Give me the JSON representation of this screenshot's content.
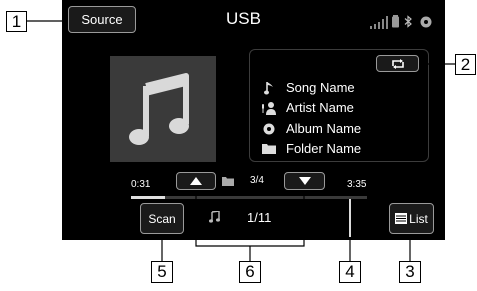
{
  "header": {
    "source_label": "Source",
    "title": "USB"
  },
  "track_info": {
    "song": "Song Name",
    "artist": "Artist Name",
    "album": "Album Name",
    "folder": "Folder Name"
  },
  "folder_nav": {
    "position": "3/4"
  },
  "playback": {
    "elapsed": "0:31",
    "total": "3:35",
    "progress_fraction": 0.144
  },
  "bottom_bar": {
    "scan_label": "Scan",
    "track_counter": "1/11",
    "list_label": "List"
  },
  "callouts": [
    "1",
    "2",
    "3",
    "4",
    "5",
    "6"
  ],
  "colors": {
    "screen_bg": "#000000",
    "button_border": "#9a9a9a",
    "text": "#ffffff"
  }
}
